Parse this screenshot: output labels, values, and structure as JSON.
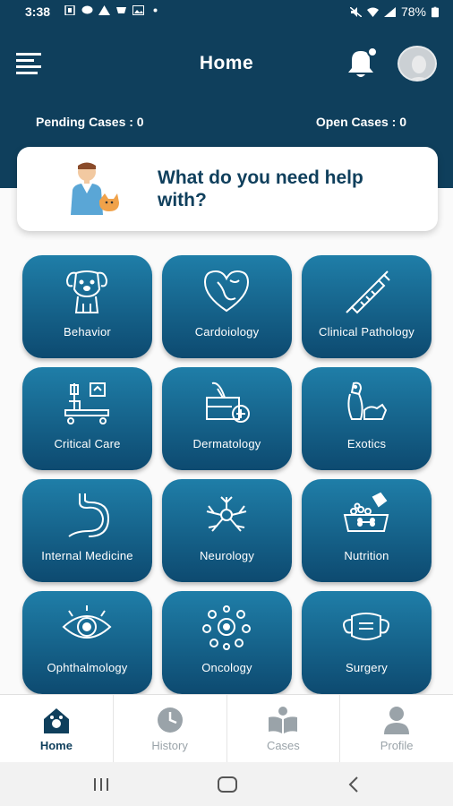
{
  "status_bar": {
    "time": "3:38",
    "battery": "78%"
  },
  "header": {
    "title": "Home",
    "pending_cases": "Pending Cases : 0",
    "open_cases": "Open Cases : 0"
  },
  "help_card": {
    "text": "What do you need help with?"
  },
  "categories": [
    {
      "label": "Behavior",
      "icon": "dog-icon"
    },
    {
      "label": "Cardoiology",
      "icon": "heart-paw-icon"
    },
    {
      "label": "Clinical Pathology",
      "icon": "syringe-icon"
    },
    {
      "label": "Critical Care",
      "icon": "hospital-bed-icon"
    },
    {
      "label": "Dermatology",
      "icon": "skin-icon"
    },
    {
      "label": "Exotics",
      "icon": "bird-dog-icon"
    },
    {
      "label": "Internal Medicine",
      "icon": "stomach-icon"
    },
    {
      "label": "Neurology",
      "icon": "neuron-icon"
    },
    {
      "label": "Nutrition",
      "icon": "food-bowl-icon"
    },
    {
      "label": "Ophthalmology",
      "icon": "eye-icon"
    },
    {
      "label": "Oncology",
      "icon": "cells-icon"
    },
    {
      "label": "Surgery",
      "icon": "mask-icon"
    }
  ],
  "bottom_nav": [
    {
      "label": "Home",
      "icon": "home-icon",
      "active": true
    },
    {
      "label": "History",
      "icon": "clock-icon",
      "active": false
    },
    {
      "label": "Cases",
      "icon": "book-icon",
      "active": false
    },
    {
      "label": "Profile",
      "icon": "person-icon",
      "active": false
    }
  ],
  "colors": {
    "primary": "#0f3f5c",
    "tile_top": "#1f7ea8",
    "tile_bottom": "#0d4a70",
    "nav_inactive": "#9aa3a9"
  }
}
